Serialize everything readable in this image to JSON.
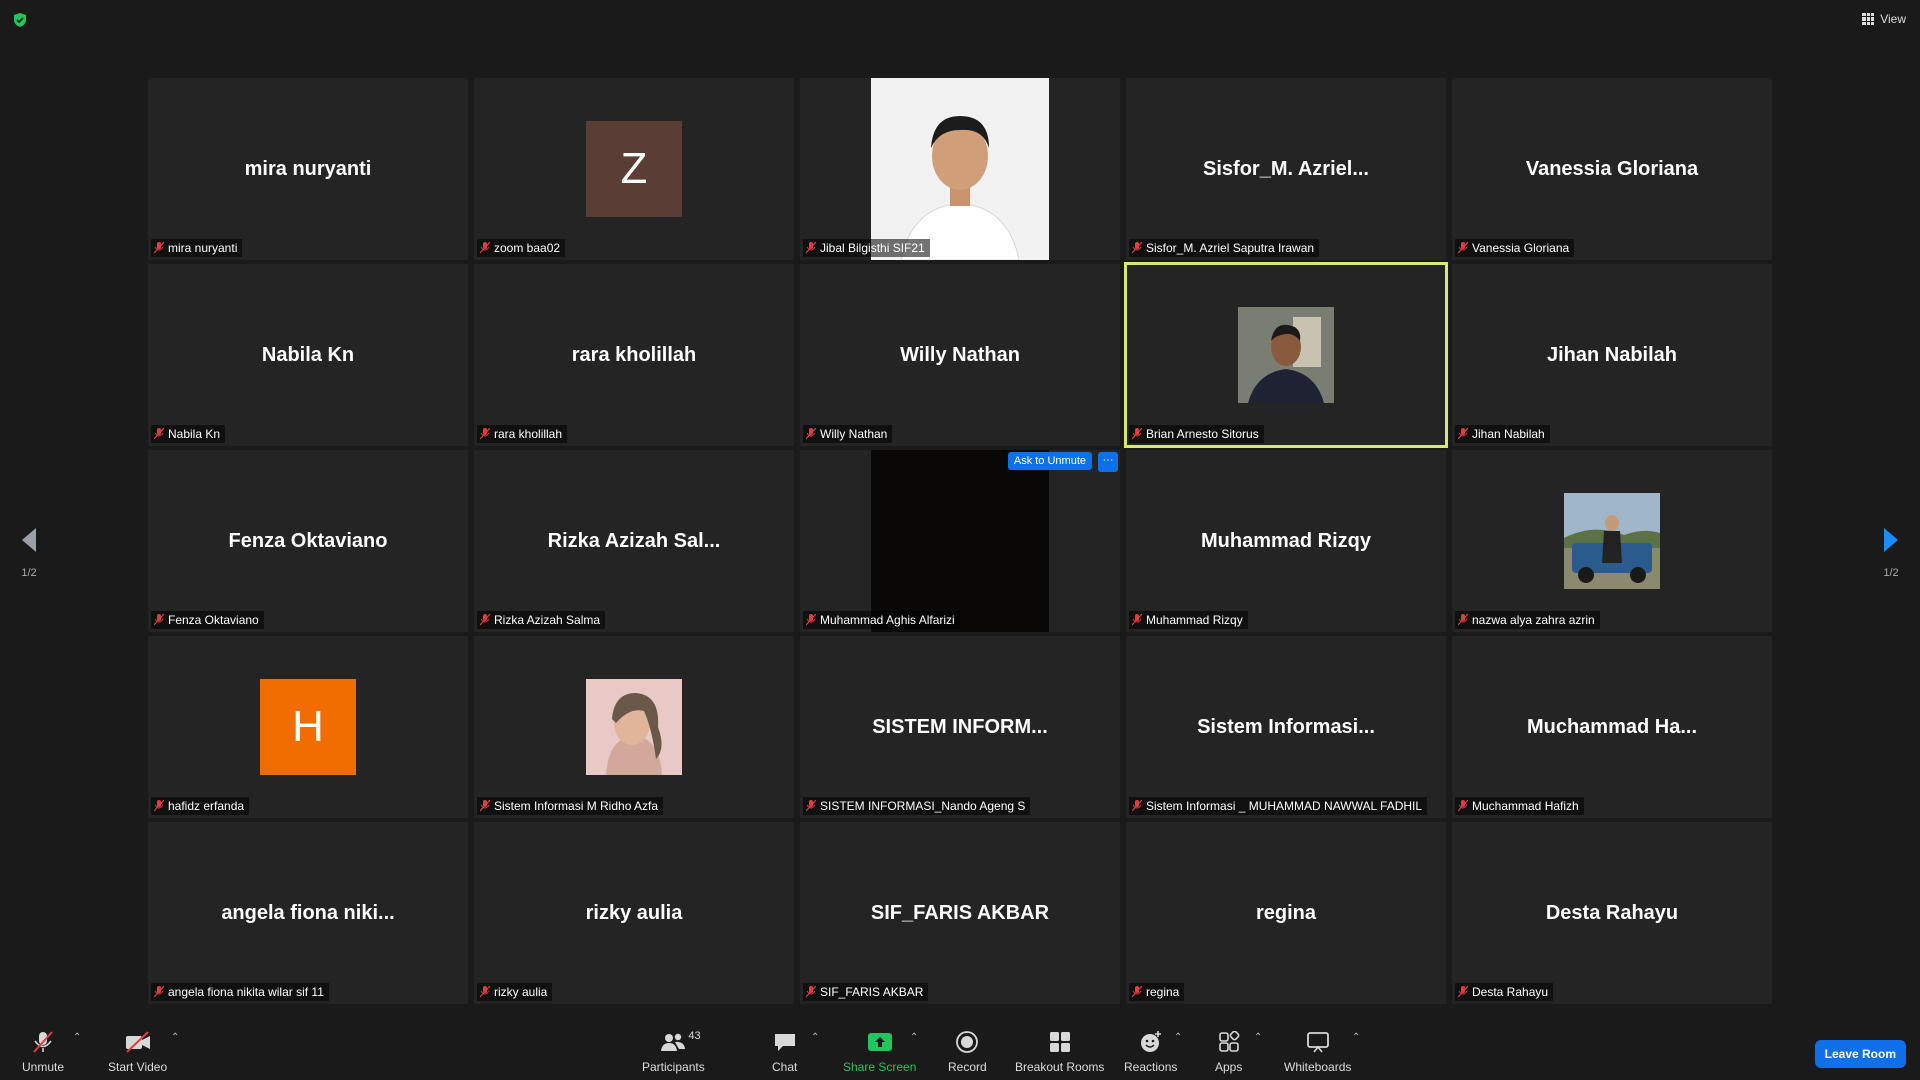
{
  "header": {
    "view_label": "View"
  },
  "pager": {
    "left": "1/2",
    "right": "1/2"
  },
  "tiles": [
    {
      "center": "mira nuryanti",
      "label": "mira nuryanti"
    },
    {
      "center": "Z",
      "label": "zoom baa02",
      "avatar_color": "#5a3d35"
    },
    {
      "center": "",
      "label": "Jibal Bilgisthi SIF21"
    },
    {
      "center": "Sisfor_M.  Azriel...",
      "label": "Sisfor_M. Azriel Saputra Irawan"
    },
    {
      "center": "Vanessia Gloriana",
      "label": "Vanessia Gloriana"
    },
    {
      "center": "Nabila Kn",
      "label": "Nabila Kn"
    },
    {
      "center": "rara kholillah",
      "label": "rara kholillah"
    },
    {
      "center": "Willy Nathan",
      "label": "Willy Nathan"
    },
    {
      "center": "",
      "label": "Brian Arnesto Sitorus"
    },
    {
      "center": "Jihan Nabilah",
      "label": "Jihan Nabilah"
    },
    {
      "center": "Fenza Oktaviano",
      "label": "Fenza Oktaviano"
    },
    {
      "center": "Rizka  Azizah  Sal...",
      "label": "Rizka Azizah Salma"
    },
    {
      "center": "",
      "label": "Muhammad Aghis Alfarizi",
      "ask_unmute": "Ask to Unmute",
      "more": "···"
    },
    {
      "center": "Muhammad  Rizqy",
      "label": "Muhammad Rizqy"
    },
    {
      "center": "",
      "label": "nazwa alya zahra azrin"
    },
    {
      "center": "H",
      "label": "hafidz erfanda",
      "avatar_color": "#f26d00"
    },
    {
      "center": "",
      "label": "Sistem Informasi M Ridho Azfa"
    },
    {
      "center": "SISTEM  INFORM...",
      "label": "SISTEM INFORMASI_Nando Ageng S"
    },
    {
      "center": "Sistem  Informasi...",
      "label": "Sistem Informasi _ MUHAMMAD NAWWAL FADHIL"
    },
    {
      "center": "Muchammad  Ha...",
      "label": "Muchammad Hafizh"
    },
    {
      "center": "angela  fiona  niki...",
      "label": "angela fiona nikita wilar sif 11"
    },
    {
      "center": "rizky aulia",
      "label": "rizky aulia"
    },
    {
      "center": "SIF_FARIS AKBAR",
      "label": "SIF_FARIS AKBAR"
    },
    {
      "center": "regina",
      "label": "regina"
    },
    {
      "center": "Desta Rahayu",
      "label": "Desta Rahayu"
    }
  ],
  "toolbar": {
    "unmute": "Unmute",
    "start_video": "Start Video",
    "participants": "Participants",
    "participants_count": "43",
    "chat": "Chat",
    "share_screen": "Share Screen",
    "record": "Record",
    "breakout_rooms": "Breakout Rooms",
    "reactions": "Reactions",
    "apps": "Apps",
    "whiteboards": "Whiteboards",
    "leave_room": "Leave Room"
  },
  "colors": {
    "active_border": "#d4ec6a",
    "accent_blue": "#0e71eb",
    "share_green": "#22c55e",
    "mute_red": "#e03e3e"
  }
}
